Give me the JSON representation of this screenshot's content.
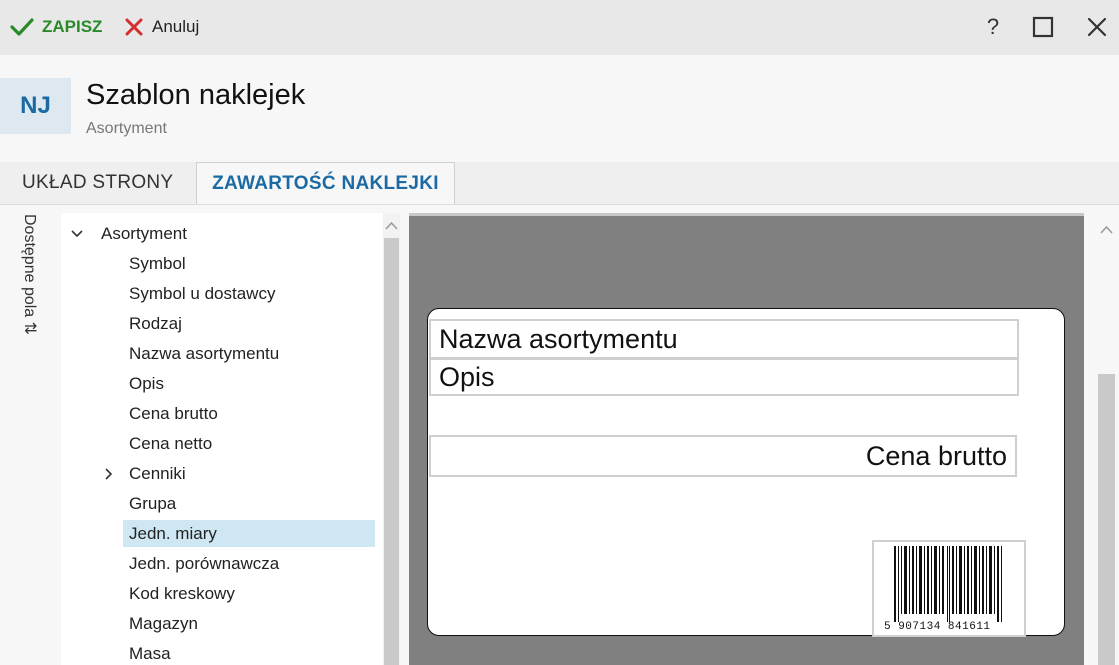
{
  "toolbar": {
    "save_label": "ZAPISZ",
    "cancel_label": "Anuluj",
    "help_label": "?"
  },
  "header": {
    "badge": "NJ",
    "title": "Szablon naklejek",
    "subtitle": "Asortyment"
  },
  "tabs": [
    {
      "label": "UKŁAD STRONY",
      "active": false
    },
    {
      "label": "ZAWARTOŚĆ NAKLEJKI",
      "active": true
    }
  ],
  "side_panel_label": "Dostępne pola ⇅",
  "tree": {
    "root": "Asortyment",
    "items": [
      "Symbol",
      "Symbol u dostawcy",
      "Rodzaj",
      "Nazwa asortymentu",
      "Opis",
      "Cena brutto",
      "Cena netto",
      "Cenniki",
      "Grupa",
      "Jedn. miary",
      "Jedn. porównawcza",
      "Kod kreskowy",
      "Magazyn",
      "Masa"
    ],
    "selected": "Jedn. miary",
    "expandable": "Cenniki"
  },
  "label_fields": {
    "name": "Nazwa asortymentu",
    "description": "Opis",
    "price": "Cena brutto",
    "barcode_digits": "5 907134 841611"
  },
  "colors": {
    "accent": "#1b6aa3",
    "save_green": "#2a8a2a",
    "cancel_red": "#d32f2f",
    "selected_row": "#cfe7f3",
    "canvas_gray": "#808080"
  }
}
